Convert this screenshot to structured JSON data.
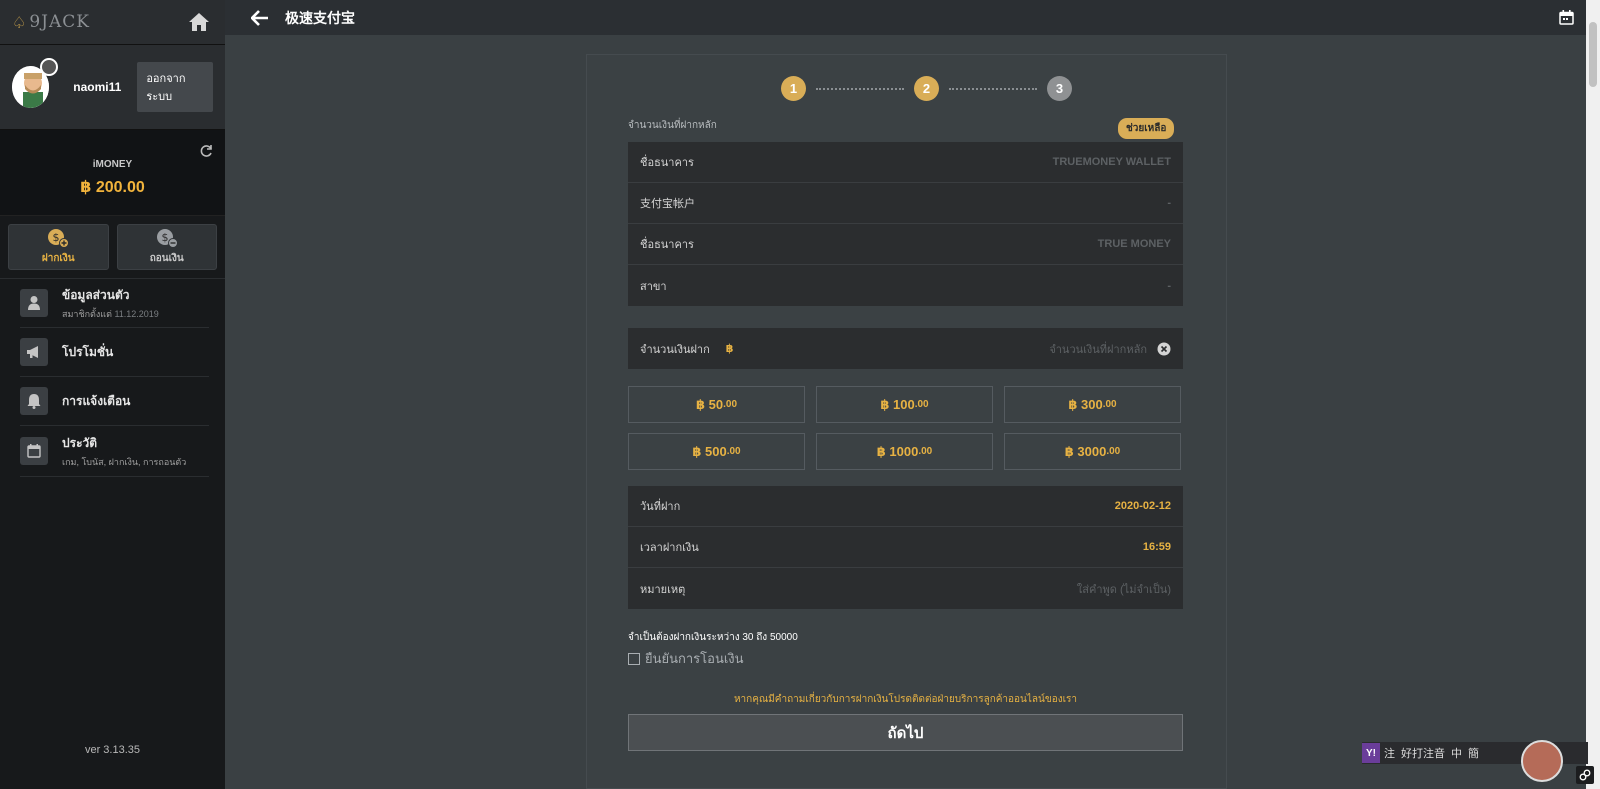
{
  "sidebar": {
    "logo_text": "9JACK",
    "username": "naomi11",
    "logout_label": "ออกจากระบบ",
    "wallet": {
      "label": "iMONEY",
      "amount": "฿ 200.00"
    },
    "deposit_label": "ฝากเงิน",
    "withdraw_label": "ถอนเงิน",
    "menu": [
      {
        "title": "ข้อมูลส่วนตัว",
        "sub_prefix": "สมาชิกตั้งแต่",
        "sub_value": "11.12.2019"
      },
      {
        "title": "โปรโมชั่น"
      },
      {
        "title": "การแจ้งเตือน"
      },
      {
        "title": "ประวัติ",
        "sub": "เกม, โบนัส, ฝากเงิน, การถอนตัว"
      }
    ],
    "version": "ver 3.13.35"
  },
  "header": {
    "title": "极速支付宝"
  },
  "stepper": {
    "steps": [
      "1",
      "2",
      "3"
    ],
    "current": 2
  },
  "form": {
    "min_label": "จำนวนเงินที่ฝากหลัก",
    "help_label": "ช่วยเหลือ",
    "bank_info": [
      {
        "key": "ชื่อธนาคาร",
        "value": "TRUEMONEY WALLET"
      },
      {
        "key": "支付宝帐户",
        "value": "-"
      },
      {
        "key": "ชื่อธนาคาร",
        "value": "TRUE MONEY"
      },
      {
        "key": "สาขา",
        "value": "-"
      }
    ],
    "amount_label": "จำนวนเงินฝาก",
    "amount_currency": "฿",
    "amount_placeholder": "จำนวนเงินที่ฝากหลัก",
    "quick_amounts": [
      {
        "main": "฿ 50",
        "dec": ".00"
      },
      {
        "main": "฿ 100",
        "dec": ".00"
      },
      {
        "main": "฿ 300",
        "dec": ".00"
      },
      {
        "main": "฿ 500",
        "dec": ".00"
      },
      {
        "main": "฿ 1000",
        "dec": ".00"
      },
      {
        "main": "฿ 3000",
        "dec": ".00"
      }
    ],
    "details": [
      {
        "key": "วันที่ฝาก",
        "value": "2020-02-12"
      },
      {
        "key": "เวลาฝากเงิน",
        "value": "16:59"
      },
      {
        "key": "หมายเหตุ",
        "value": "ใส่คำพูด (ไม่จำเป็น)"
      }
    ],
    "range_note": "จำเป็นต้องฝากเงินระหว่าง 30 ถึง 50000",
    "confirm_label": "ยืนยันการโอนเงิน",
    "contact_note": "หากคุณมีคำถามเกี่ยวกับการฝากเงินโปรดติดต่อฝ่ายบริการลูกค้าออนไลน์ของเรา",
    "next_label": "ถัดไป"
  },
  "ime": {
    "logo": "Y!",
    "items": [
      "注",
      "好打注音",
      "中",
      "簡"
    ]
  },
  "colors": {
    "accent_gold": "#e7b243",
    "step_active": "#d9ad57",
    "sidebar_bg": "#17191b",
    "main_bg": "#3a4043"
  }
}
